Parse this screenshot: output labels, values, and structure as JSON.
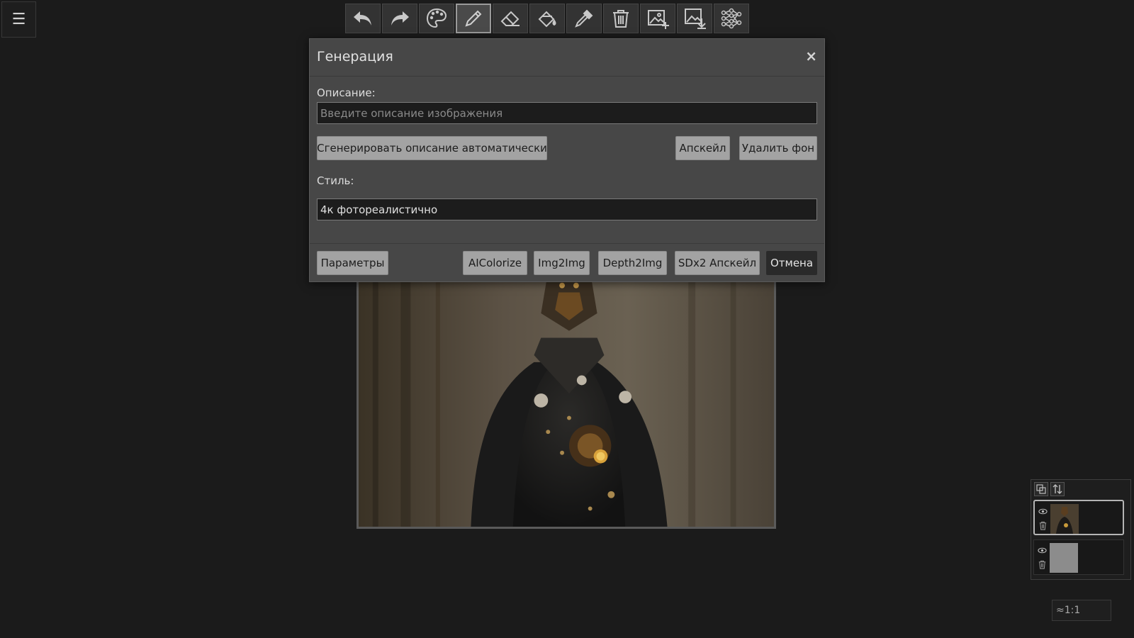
{
  "menu": {
    "label": "☰"
  },
  "toolbar": {
    "tools": [
      {
        "icon": "undo-icon",
        "active": false
      },
      {
        "icon": "redo-icon",
        "active": false
      },
      {
        "icon": "palette-icon",
        "active": false
      },
      {
        "icon": "pencil-icon",
        "active": true
      },
      {
        "icon": "eraser-icon",
        "active": false
      },
      {
        "icon": "fill-bucket-icon",
        "active": false
      },
      {
        "icon": "eyedropper-icon",
        "active": false
      },
      {
        "icon": "trash-icon",
        "active": false
      },
      {
        "icon": "add-image-icon",
        "active": false
      },
      {
        "icon": "download-image-icon",
        "active": false
      },
      {
        "icon": "neural-network-icon",
        "active": false
      }
    ]
  },
  "dialog": {
    "title": "Генерация",
    "close": "×",
    "description_label": "Описание:",
    "description_placeholder": "Введите описание изображения",
    "description_value": "",
    "auto_describe_button": "Сгенерировать описание автоматически",
    "upscale_button": "Апскейл",
    "remove_bg_button": "Удалить фон",
    "style_label": "Стиль:",
    "style_value": "4к фотореалистично",
    "footer": {
      "params_button": "Параметры",
      "aicolorize_button": "AIColorize",
      "img2img_button": "Img2Img",
      "depth2img_button": "Depth2Img",
      "sdx2_button": "SDx2 Апскейл",
      "cancel_button": "Отмена"
    }
  },
  "layers": {
    "items": [
      {
        "name": "layer-1",
        "visible": true,
        "selected": true
      },
      {
        "name": "layer-2",
        "visible": true,
        "selected": false
      }
    ]
  },
  "zoom": {
    "label": "≈1:1"
  },
  "colors": {
    "background": "#1b1b1b",
    "dialog": "#474747",
    "button": "#a3a3a3",
    "cancel": "#2a2a2a"
  }
}
